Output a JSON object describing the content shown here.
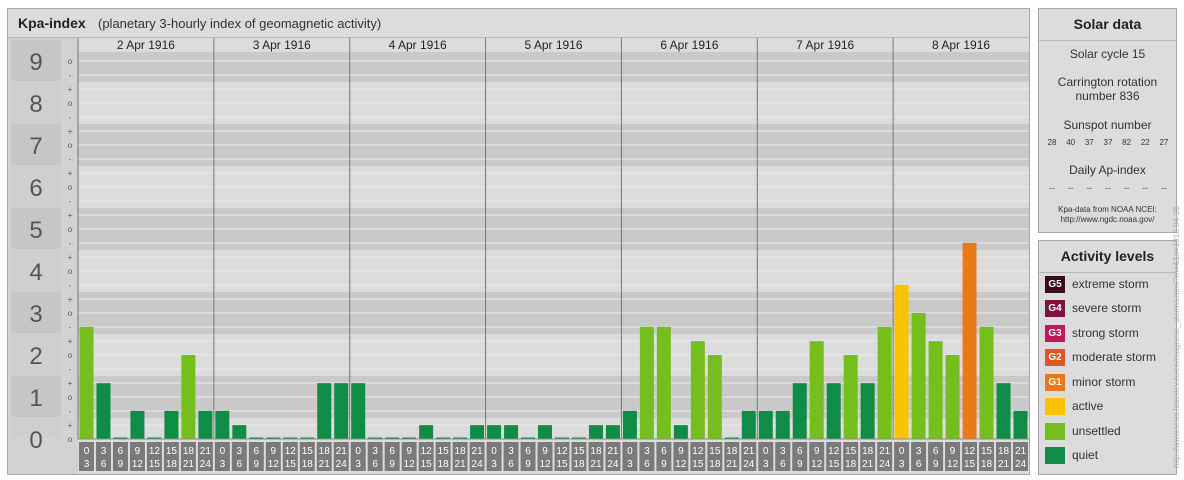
{
  "header": {
    "title": "Kpa-index",
    "subtitle": "(planetary 3-hourly index of geomagnetic activity)"
  },
  "chart_data": {
    "type": "bar",
    "title": "Kpa-index",
    "subtitle": "(planetary 3-hourly index of geomagnetic activity)",
    "y_ticks": [
      "0",
      "1",
      "2",
      "3",
      "4",
      "5",
      "6",
      "7",
      "8",
      "9"
    ],
    "sub_tick_labels": [
      "o",
      "+",
      "-"
    ],
    "ylim": [
      0,
      9.33
    ],
    "days": [
      "2 Apr 1916",
      "3 Apr 1916",
      "4 Apr 1916",
      "5 Apr 1916",
      "6 Apr 1916",
      "7 Apr 1916",
      "8 Apr 1916"
    ],
    "interval_start": [
      "0",
      "3",
      "6",
      "9",
      "12",
      "15",
      "18",
      "21"
    ],
    "interval_end": [
      "3",
      "6",
      "9",
      "12",
      "15",
      "18",
      "21",
      "24"
    ],
    "values": [
      2.67,
      1.33,
      0,
      0.67,
      0,
      0.67,
      2,
      0.67,
      0.67,
      0.33,
      0,
      0,
      0,
      0,
      1.33,
      1.33,
      1.33,
      0,
      0,
      0,
      0.33,
      0,
      0,
      0.33,
      0.33,
      0.33,
      0,
      0.33,
      0,
      0,
      0.33,
      0.33,
      0.67,
      2.67,
      2.67,
      0.33,
      2.33,
      2,
      0,
      0.67,
      0.67,
      0.67,
      1.33,
      2.33,
      1.33,
      2,
      1.33,
      2.67,
      3.67,
      3,
      2.33,
      2,
      4.67,
      2.67,
      1.33,
      0.67
    ],
    "colors": {
      "quiet": "#0f8c45",
      "unsettled": "#74be1e",
      "active": "#f9c300",
      "G1": "#e87a1a",
      "G2": "#e0561e",
      "G3": "#bd1a5c",
      "G4": "#7d1243",
      "G5": "#3a0a1f"
    },
    "grid": true,
    "legend": "right"
  },
  "solar": {
    "heading": "Solar data",
    "cycle": "Solar cycle 15",
    "carrington_line1": "Carrington rotation",
    "carrington_line2": "number 836",
    "sunspot_label": "Sunspot number",
    "sunspot_values": [
      "28",
      "40",
      "37",
      "37",
      "82",
      "22",
      "27"
    ],
    "ap_label": "Daily Ap-index",
    "ap_values": [
      "--",
      "--",
      "--",
      "--",
      "--",
      "--",
      "--"
    ],
    "credit_line1": "Kpa-data from NOAA NCEI:",
    "credit_line2": "http://www.ngdc.noaa.gov/"
  },
  "activity": {
    "heading": "Activity levels",
    "items": [
      {
        "badge": "G5",
        "label": "extreme storm",
        "color": "#3a0a1f"
      },
      {
        "badge": "G4",
        "label": "severe storm",
        "color": "#7d1243"
      },
      {
        "badge": "G3",
        "label": "strong storm",
        "color": "#bd1a5c"
      },
      {
        "badge": "G2",
        "label": "moderate storm",
        "color": "#e0561e"
      },
      {
        "badge": "G1",
        "label": "minor storm",
        "color": "#e87a1a"
      },
      {
        "badge": "",
        "label": "active",
        "color": "#f9c300"
      },
      {
        "badge": "",
        "label": "unsettled",
        "color": "#74be1e"
      },
      {
        "badge": "",
        "label": "quiet",
        "color": "#0f8c45"
      }
    ]
  },
  "watermark": "http://www.tesis.lebedev.ru/en/magnetic_storms.html?m=4&d=1916-04-08"
}
